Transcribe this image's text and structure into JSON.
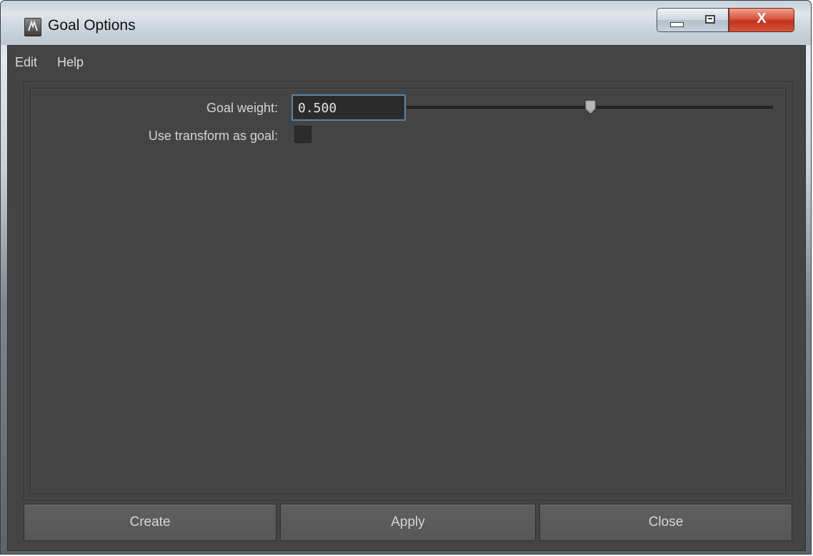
{
  "window": {
    "title": "Goal Options"
  },
  "menu": {
    "items": [
      "Edit",
      "Help"
    ]
  },
  "form": {
    "goal_weight": {
      "label": "Goal weight:",
      "value": "0.500",
      "level": 0.5
    },
    "use_transform": {
      "label": "Use transform as goal:",
      "checked": false
    }
  },
  "buttons": {
    "create": "Create",
    "apply": "Apply",
    "close": "Close"
  },
  "title_buttons": {
    "close_glyph": "X"
  },
  "colors": {
    "panel": "#444444",
    "field_focus": "#5e83a8",
    "close_red": "#c0321b"
  }
}
